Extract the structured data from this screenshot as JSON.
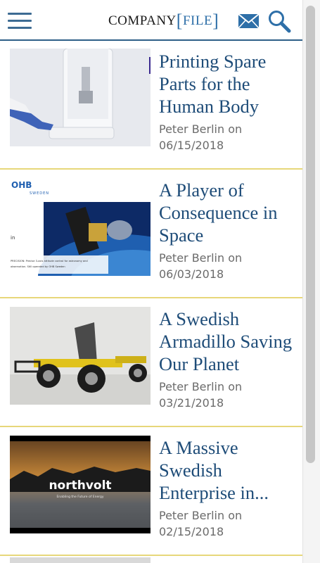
{
  "header": {
    "logo_company": "COMPANY",
    "logo_bracket_open": "[",
    "logo_file": "FILE",
    "logo_bracket_close": "]",
    "menu_icon": "hamburger-menu-icon",
    "mail_icon": "mail-icon",
    "search_icon": "search-icon"
  },
  "colors": {
    "accent_blue": "#1e4c78",
    "divider_gold": "#e7d77a",
    "header_rule": "#2e5f87"
  },
  "articles": [
    {
      "title_lines": [
        "Printing Spare",
        "Parts for the",
        "Human Body"
      ],
      "author_line": "Peter Berlin on",
      "date": "06/15/2018"
    },
    {
      "title_lines": [
        "A Player of",
        "Consequence in",
        "Space"
      ],
      "author_line": "Peter Berlin on",
      "date": "06/03/2018",
      "image_text": {
        "brand": "OHB",
        "brand_sub": "SWEDEN",
        "side": "in",
        "caption_1": "PRECISION: Precise 3-axis attitude control for astronomy and",
        "caption_2": "observation. Still operated by OHB Sweden"
      }
    },
    {
      "title_lines": [
        "A Swedish",
        "Armadillo Saving",
        "Our Planet"
      ],
      "author_line": "Peter Berlin on",
      "date": "03/21/2018"
    },
    {
      "title_lines": [
        "A Massive",
        "Swedish",
        "Enterprise in..."
      ],
      "author_line": "Peter Berlin on",
      "date": "02/15/2018",
      "image_text": {
        "brand": "northvolt",
        "tagline": "Enabling the Future of Energy"
      }
    }
  ]
}
